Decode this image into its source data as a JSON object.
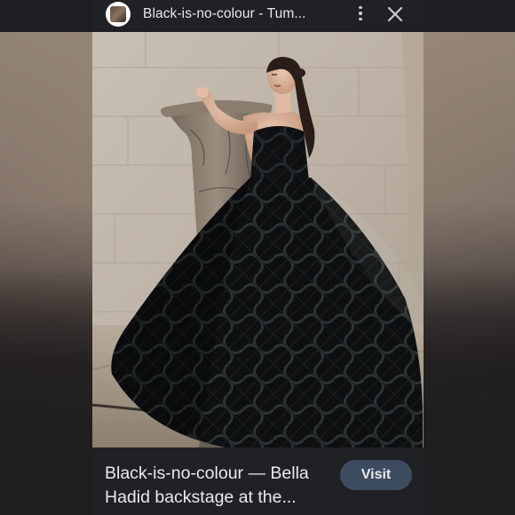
{
  "header": {
    "site_title": "Black-is-no-colour - Tum...",
    "favicon_icon": "site-favicon-icon",
    "menu_icon": "more-vert-icon",
    "close_icon": "close-icon"
  },
  "image": {
    "subject": "photo"
  },
  "caption": {
    "text": "Black-is-no-colour — Bella Hadid backstage at the...",
    "visit_label": "Visit"
  },
  "colors": {
    "bar_background": "#202124",
    "text": "#e8eaed",
    "visit_button": "#3c4b5e"
  }
}
